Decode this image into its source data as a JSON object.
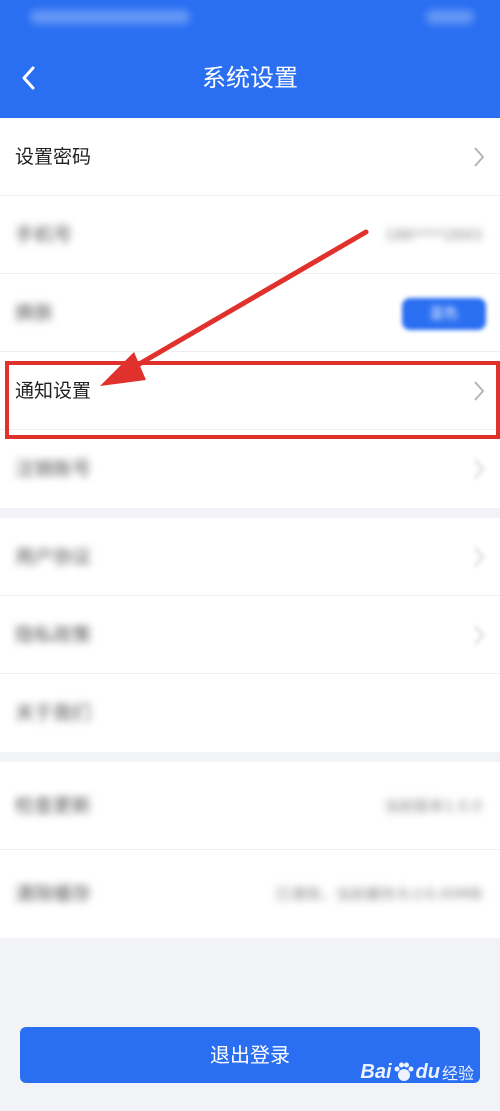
{
  "header": {
    "title": "系统设置"
  },
  "settings": {
    "items": [
      {
        "label": "设置密码",
        "value": "",
        "has_chevron": true,
        "blurred": false
      },
      {
        "label": "手机号",
        "value": "186****2693",
        "has_chevron": false,
        "blurred": true
      },
      {
        "label": "换肤",
        "value": "蓝色",
        "has_chevron": false,
        "blurred": true
      },
      {
        "label": "通知设置",
        "value": "",
        "has_chevron": true,
        "blurred": false
      },
      {
        "label": "注销账号",
        "value": "",
        "has_chevron": true,
        "blurred": true
      },
      {
        "label": "用户协议",
        "value": "",
        "has_chevron": true,
        "blurred": true
      },
      {
        "label": "隐私政策",
        "value": "",
        "has_chevron": true,
        "blurred": true
      },
      {
        "label": "关于我们",
        "value": "",
        "has_chevron": false,
        "blurred": true
      },
      {
        "label": "检查更新",
        "value": "当前版本1.0.0",
        "has_chevron": false,
        "blurred": true
      },
      {
        "label": "清除缓存",
        "value": "已清除，当前缓存大小0.00MB",
        "has_chevron": false,
        "blurred": true
      }
    ]
  },
  "footer": {
    "logout_label": "退出登录"
  },
  "watermark": {
    "brand_a": "Bai",
    "brand_b": "du",
    "suffix": "经验"
  },
  "colors": {
    "primary": "#2a6ff2",
    "annotation_red": "#e1312d"
  }
}
